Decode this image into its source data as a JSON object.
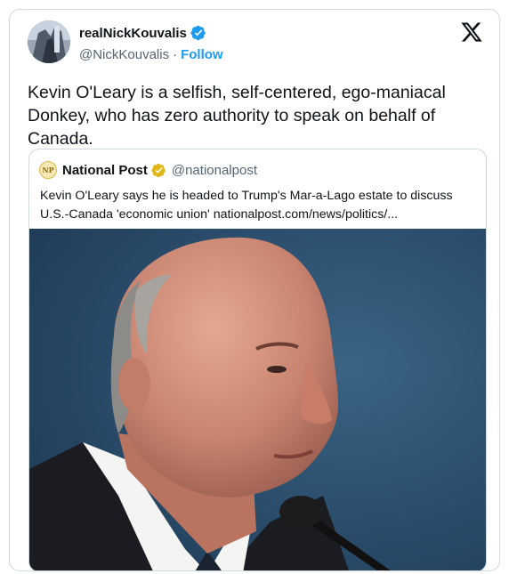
{
  "author": {
    "display_name": "realNickKouvalis",
    "handle": "@NickKouvalis",
    "separator": "·",
    "follow_label": "Follow"
  },
  "tweet": {
    "text": "Kevin O'Leary is a selfish, self-centered, ego-maniacal Donkey, who has zero authority to speak on behalf of Canada."
  },
  "quoted_tweet": {
    "display_name": "National Post",
    "handle": "@nationalpost",
    "logo_text": "NP",
    "text": "Kevin O'Leary says he is headed to Trump's Mar-a-Lago estate to discuss U.S.-Canada 'economic union' nationalpost.com/news/politics/..."
  },
  "colors": {
    "verified_blue": "#1d9bf0",
    "verified_gold": "#e2b719",
    "link_blue": "#1d9bf0",
    "photo_background": "#2b4e6e"
  },
  "icons": {
    "verified": "verified-badge-icon",
    "brand": "x-logo-icon"
  }
}
